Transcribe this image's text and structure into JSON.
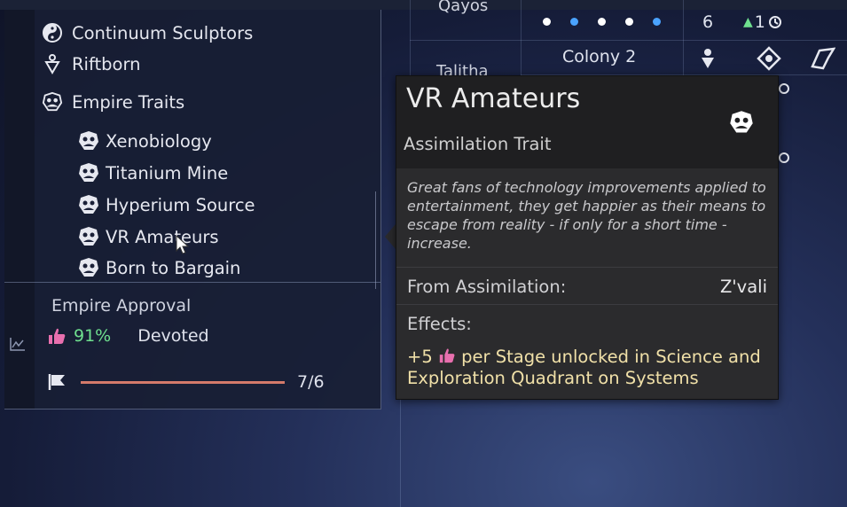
{
  "background": {
    "planets": [
      {
        "name": "Qayos"
      },
      {
        "name": "Talitha"
      }
    ],
    "row1": {
      "dots": [
        {
          "color": "#ffffff"
        },
        {
          "color": "#4aa3ff"
        },
        {
          "color": "#ffffff"
        },
        {
          "color": "#ffffff"
        },
        {
          "color": "#4aa3ff"
        }
      ],
      "count": "6",
      "growth": "1"
    },
    "row2": {
      "colony": "Colony 2"
    }
  },
  "left_panel": {
    "factions": [
      {
        "label": "Continuum Sculptors",
        "icon": "yin-yang-icon"
      },
      {
        "label": "Riftborn",
        "icon": "riftborn-icon"
      }
    ],
    "traits_header": "Empire Traits",
    "traits": [
      {
        "label": "Xenobiology",
        "icon": "trait-icon"
      },
      {
        "label": "Titanium Mine",
        "icon": "trait-icon"
      },
      {
        "label": "Hyperium Source",
        "icon": "trait-icon"
      },
      {
        "label": "VR Amateurs",
        "icon": "trait-icon"
      },
      {
        "label": "Born to Bargain",
        "icon": "trait-icon"
      }
    ],
    "approval": {
      "title": "Empire Approval",
      "percent": "91%",
      "state": "Devoted",
      "progress_text": "7/6",
      "progress_fraction": 1.0
    }
  },
  "tooltip": {
    "title": "VR Amateurs",
    "subtitle": "Assimilation Trait",
    "description": "Great fans of technology improvements applied to entertainment, they get happier as their means to escape from reality - if only for a short time - increase.",
    "from_label": "From Assimilation:",
    "from_value": "Z'vali",
    "effects_label": "Effects:",
    "effect_amount": "+5",
    "effect_text": "per Stage unlocked in Science and Exploration Quadrant on Systems"
  },
  "colors": {
    "approval_green": "#6fe08f",
    "thumb_pink": "#e86fae",
    "effect_yellow": "#f0e0a8"
  }
}
